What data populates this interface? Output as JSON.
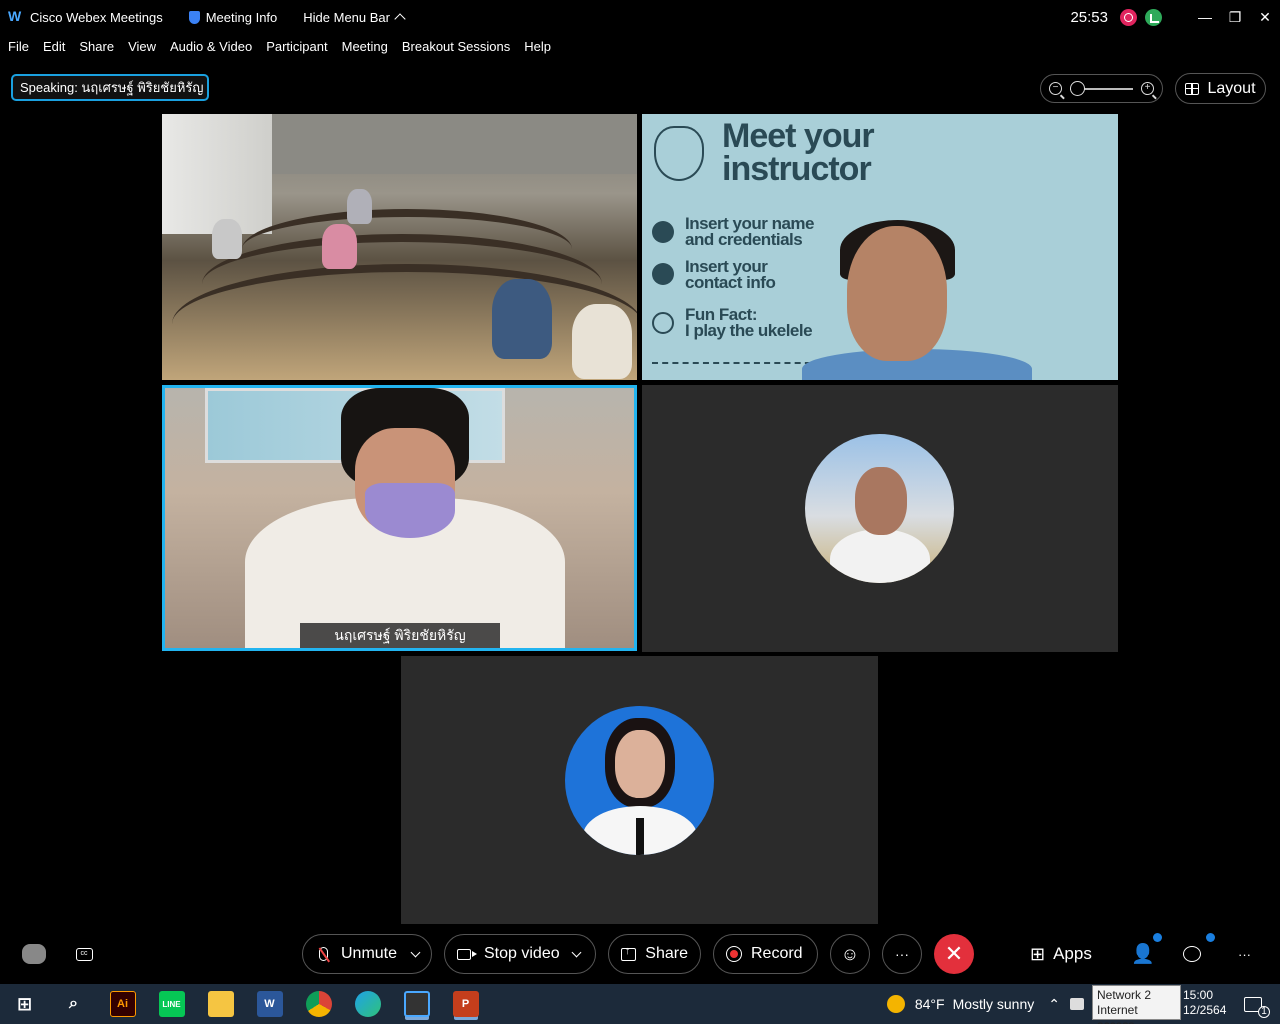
{
  "titlebar": {
    "app_name": "Cisco Webex Meetings",
    "meeting_info": "Meeting Info",
    "hide_menu": "Hide Menu Bar",
    "timer": "25:53"
  },
  "menu": [
    "File",
    "Edit",
    "Share",
    "View",
    "Audio & Video",
    "Participant",
    "Meeting",
    "Breakout Sessions",
    "Help"
  ],
  "speaking_label": "Speaking: นฤเศรษฐ์ พิริยชัยหิรัญ",
  "layout_label": "Layout",
  "slide": {
    "title_line1": "Meet your",
    "title_line2": "instructor",
    "line1a": "Insert your name",
    "line1b": "and credentials",
    "line2a": "Insert your",
    "line2b": "contact info",
    "line3a": "Fun Fact:",
    "line3b": "I play the ukelele"
  },
  "speaker_name": "นฤเศรษฐ์ พิริยชัยหิรัญ",
  "controls": {
    "unmute": "Unmute",
    "stop_video": "Stop video",
    "share": "Share",
    "record": "Record",
    "more": "···",
    "apps": "Apps",
    "overflow": "···"
  },
  "taskbar": {
    "weather_temp": "84°F",
    "weather_text": "Mostly sunny",
    "network_tip_line1": "Network 2",
    "network_tip_line2": "Internet access",
    "clock_time": "15:00",
    "clock_date": "12/2564",
    "notification_count": "1"
  },
  "colors": {
    "accent_blue": "#22b4f0",
    "end_red": "#e3303c",
    "record_red": "#e0245e"
  }
}
